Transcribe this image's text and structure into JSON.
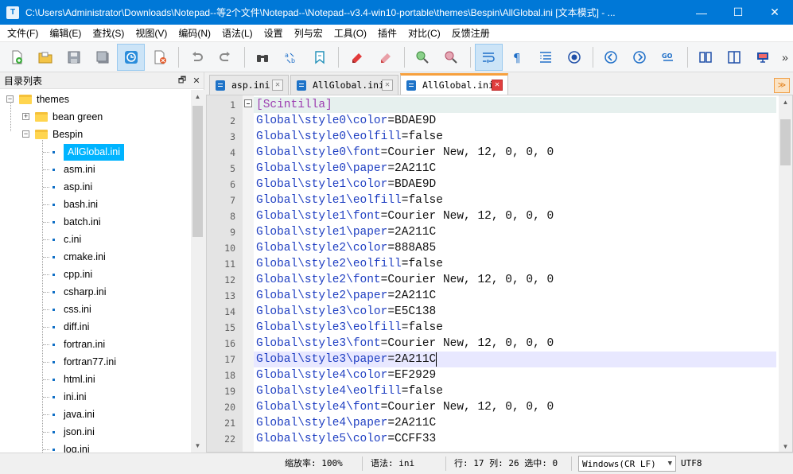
{
  "window": {
    "app_icon": "T",
    "title": "C:\\Users\\Administrator\\Downloads\\Notepad--等2个文件\\Notepad--\\Notepad--v3.4-win10-portable\\themes\\Bespin\\AllGlobal.ini [文本模式] - ...",
    "minimize": "—",
    "maximize": "☐",
    "close": "✕"
  },
  "menu": [
    "文件(F)",
    "编辑(E)",
    "查找(S)",
    "视图(V)",
    "编码(N)",
    "语法(L)",
    "设置",
    "列与宏",
    "工具(O)",
    "插件",
    "对比(C)",
    "反馈注册"
  ],
  "toolbar": {
    "icons": [
      "new-file-icon",
      "open-file-icon",
      "save-icon",
      "save-all-icon",
      "file-switch-icon",
      "close-file-icon",
      "undo-icon",
      "redo-icon",
      "binoculars-icon",
      "replace-icon",
      "bookmark-icon",
      "mark-icon",
      "clear-mark-icon",
      "zoom-in-icon",
      "zoom-out-icon",
      "word-wrap-icon",
      "show-symbols-icon",
      "indent-guide-icon",
      "record-macro-icon",
      "prev-icon",
      "next-icon",
      "goto-icon",
      "compare-icon",
      "split-view-icon",
      "monitor-icon"
    ],
    "active_icon": "file-switch-icon",
    "overflow": "»"
  },
  "file_panel": {
    "title": "目录列表",
    "pin": "🗗",
    "close": "✕",
    "tree": {
      "root": "themes",
      "folders": [
        "bean green",
        "Bespin"
      ],
      "files": [
        "AllGlobal.ini",
        "asm.ini",
        "asp.ini",
        "bash.ini",
        "batch.ini",
        "c.ini",
        "cmake.ini",
        "cpp.ini",
        "csharp.ini",
        "css.ini",
        "diff.ini",
        "fortran.ini",
        "fortran77.ini",
        "html.ini",
        "ini.ini",
        "java.ini",
        "json.ini",
        "log.ini"
      ],
      "selected": "AllGlobal.ini"
    },
    "scroll_up": "▲",
    "scroll_down": "▼"
  },
  "tabs": [
    {
      "label": "asp.ini",
      "close": "✕"
    },
    {
      "label": "AllGlobal.ini",
      "close": "✕"
    },
    {
      "label": "AllGlobal.ini",
      "close": "✕"
    }
  ],
  "active_tab": 2,
  "tab_menu": "≫",
  "editor": {
    "start_line": 1,
    "current_line": 17,
    "lines": [
      {
        "section": "[Scintilla]"
      },
      {
        "key": "Global\\style0\\color",
        "value": "BDAE9D"
      },
      {
        "key": "Global\\style0\\eolfill",
        "value": "false"
      },
      {
        "key": "Global\\style0\\font",
        "value": "Courier New, 12, 0, 0, 0"
      },
      {
        "key": "Global\\style0\\paper",
        "value": "2A211C"
      },
      {
        "key": "Global\\style1\\color",
        "value": "BDAE9D"
      },
      {
        "key": "Global\\style1\\eolfill",
        "value": "false"
      },
      {
        "key": "Global\\style1\\font",
        "value": "Courier New, 12, 0, 0, 0"
      },
      {
        "key": "Global\\style1\\paper",
        "value": "2A211C"
      },
      {
        "key": "Global\\style2\\color",
        "value": "888A85"
      },
      {
        "key": "Global\\style2\\eolfill",
        "value": "false"
      },
      {
        "key": "Global\\style2\\font",
        "value": "Courier New, 12, 0, 0, 0"
      },
      {
        "key": "Global\\style2\\paper",
        "value": "2A211C"
      },
      {
        "key": "Global\\style3\\color",
        "value": "E5C138"
      },
      {
        "key": "Global\\style3\\eolfill",
        "value": "false"
      },
      {
        "key": "Global\\style3\\font",
        "value": "Courier New, 12, 0, 0, 0"
      },
      {
        "key": "Global\\style3\\paper",
        "value": "2A211C"
      },
      {
        "key": "Global\\style4\\color",
        "value": "EF2929"
      },
      {
        "key": "Global\\style4\\eolfill",
        "value": "false"
      },
      {
        "key": "Global\\style4\\font",
        "value": "Courier New, 12, 0, 0, 0"
      },
      {
        "key": "Global\\style4\\paper",
        "value": "2A211C"
      },
      {
        "key": "Global\\style5\\color",
        "value": "CCFF33"
      }
    ],
    "scroll_up": "▲",
    "scroll_down": "▼"
  },
  "statusbar": {
    "zoom": "缩放率: 100%",
    "syntax": "语法: ini",
    "position": "行: 17 列: 26 选中: 0",
    "eol": "Windows(CR LF)",
    "encoding": "UTF8"
  },
  "colors": {
    "titlebar": "#0078d7",
    "key": "#1f3fc2",
    "section": "#9c3cb0",
    "current_line": "#e8e8ff",
    "first_line": "#e6f0ee",
    "tab_accent": "#f7a03d",
    "selection": "#00b4ff"
  }
}
